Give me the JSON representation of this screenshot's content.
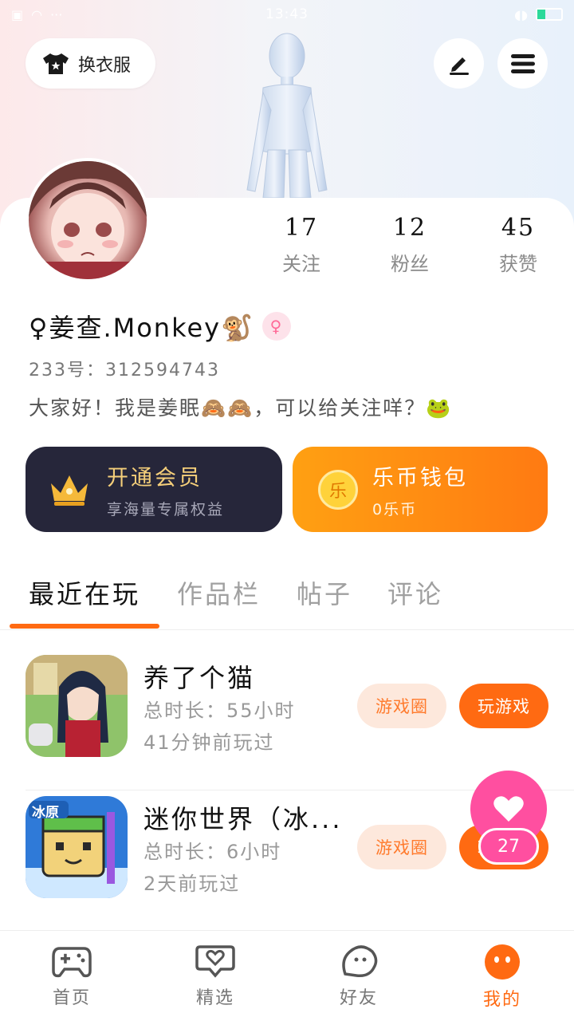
{
  "status_bar": {
    "time": "13:43"
  },
  "header": {
    "outfit_button_label": "换衣服",
    "edit_icon": "pen-icon",
    "menu_icon": "hamburger-icon"
  },
  "profile": {
    "stats": [
      {
        "value": "17",
        "label": "关注"
      },
      {
        "value": "12",
        "label": "粉丝"
      },
      {
        "value": "45",
        "label": "获赞"
      }
    ],
    "name": "♀姜查.Monkey🐒",
    "uid": "233号：312594743",
    "bio": "大家好！我是姜眠🙈🙈，可以给关注咩？🐸"
  },
  "promos": {
    "vip": {
      "title": "开通会员",
      "subtitle": "享海量专属权益"
    },
    "wallet": {
      "title": "乐币钱包",
      "subtitle": "0乐币",
      "icon_text": "乐"
    }
  },
  "tabs": [
    {
      "label": "最近在玩",
      "active": true
    },
    {
      "label": "作品栏",
      "active": false
    },
    {
      "label": "帖子",
      "active": false
    },
    {
      "label": "评论",
      "active": false
    }
  ],
  "games": [
    {
      "name": "养了个猫",
      "duration": "总时长：55小时",
      "last_played": "41分钟前玩过",
      "circle_label": "游戏圈",
      "play_label": "玩游戏"
    },
    {
      "name": "迷你世界（冰...",
      "duration": "总时长：6小时",
      "last_played": "2天前玩过",
      "circle_label": "游戏圈",
      "play_label": "玩游戏",
      "icon_text": "冰原"
    }
  ],
  "like_fab": {
    "count": "27"
  },
  "bottom_nav": [
    {
      "label": "首页",
      "icon": "gamepad-icon"
    },
    {
      "label": "精选",
      "icon": "heart-chat-icon"
    },
    {
      "label": "好友",
      "icon": "friends-icon"
    },
    {
      "label": "我的",
      "icon": "profile-face-icon",
      "active": true
    }
  ],
  "colors": {
    "accent": "#ff6a12",
    "vip_bg": "#26263a",
    "pink": "#ff4fa0"
  }
}
